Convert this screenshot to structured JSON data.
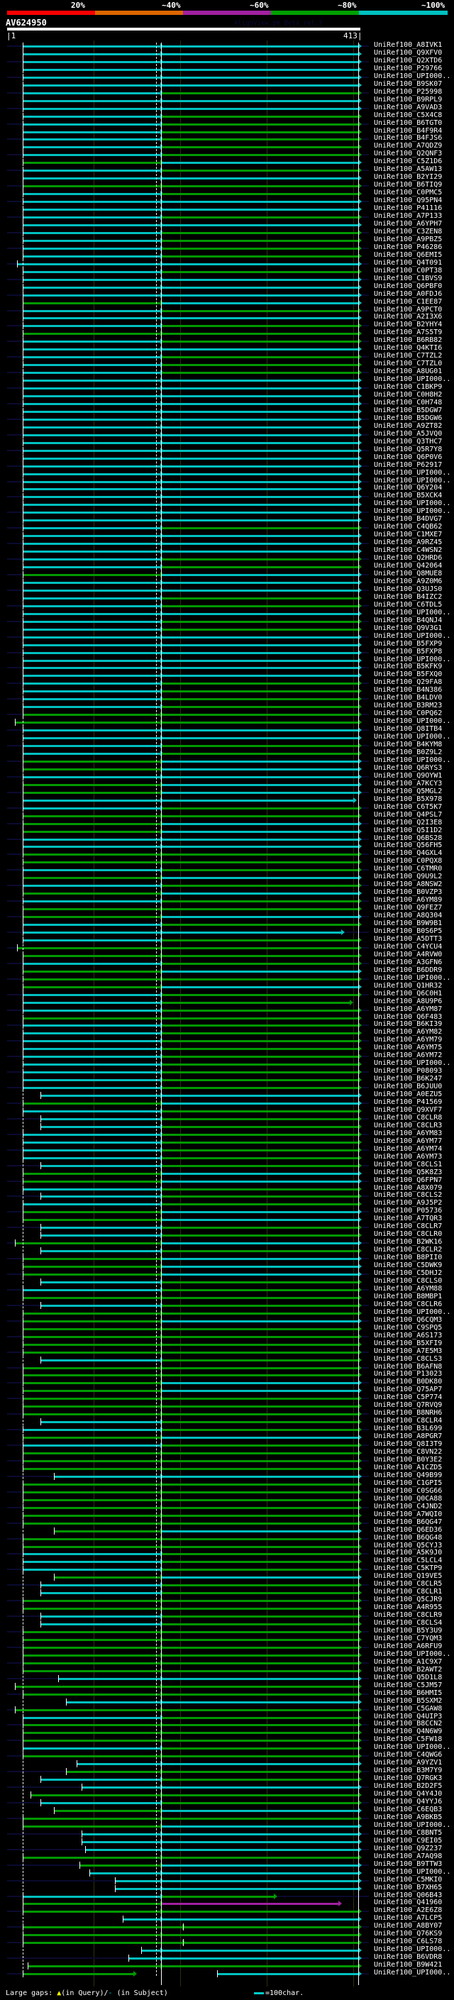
{
  "header": {
    "percent_labels": [
      "20%",
      "~40%",
      "~60%",
      "~80%",
      "~100%"
    ],
    "identity_colors": [
      "#ff0000",
      "#dd6600",
      "#a020a0",
      "#00a000",
      "#00c0c0"
    ],
    "query_name": "AV624950",
    "credit": "AlignView.pm Beta rel.7",
    "query_start": "|1",
    "query_end": "413|",
    "query_length": 413
  },
  "colors": {
    "c": "#00c0c0",
    "g": "#009900",
    "m": "#a020a0"
  },
  "hits": [
    {
      "label": "UniRef100_A8IVK1",
      "c": "cc"
    },
    {
      "label": "UniRef100_Q9XFV0",
      "c": "cc"
    },
    {
      "label": "UniRef100_Q2XTD6",
      "c": "cc"
    },
    {
      "label": "UniRef100_P29766",
      "c": "cc"
    },
    {
      "label": "UniRef100_UPI000..",
      "c": "cc"
    },
    {
      "label": "UniRef100_B9SK07",
      "c": "cc"
    },
    {
      "label": "UniRef100_P25998",
      "c": "cg"
    },
    {
      "label": "UniRef100_B9RPL9",
      "c": "cc"
    },
    {
      "label": "UniRef100_A9VAD3",
      "c": "cc"
    },
    {
      "label": "UniRef100_C5X4C8",
      "c": "cg"
    },
    {
      "label": "UniRef100_B6TGT0",
      "c": "cg"
    },
    {
      "label": "UniRef100_B4F9R4",
      "c": "cg"
    },
    {
      "label": "UniRef100_B4FJS6",
      "c": "cg"
    },
    {
      "label": "UniRef100_A7QDZ9",
      "c": "cg"
    },
    {
      "label": "UniRef100_Q2QNF3",
      "c": "cg"
    },
    {
      "label": "UniRef100_C5Z1D6",
      "c": "gc"
    },
    {
      "label": "UniRef100_A5AW13",
      "c": "cg"
    },
    {
      "label": "UniRef100_B2YI29",
      "c": "cc"
    },
    {
      "label": "UniRef100_B6TIQ9",
      "c": "gg"
    },
    {
      "label": "UniRef100_C0PMC5",
      "c": "cg"
    },
    {
      "label": "UniRef100_Q95PN4",
      "c": "cc"
    },
    {
      "label": "UniRef100_P41116",
      "c": "cc"
    },
    {
      "label": "UniRef100_A7P133",
      "c": "cg"
    },
    {
      "label": "UniRef100_A6YPH7",
      "c": "cc"
    },
    {
      "label": "UniRef100_C3ZEN8",
      "c": "cg"
    },
    {
      "label": "UniRef100_A9PBZ5",
      "c": "cg"
    },
    {
      "label": "UniRef100_P46286",
      "c": "cg"
    },
    {
      "label": "UniRef100_Q6EMI5",
      "c": "cg"
    },
    {
      "label": "UniRef100_Q4T091",
      "c": "cc",
      "s": 13
    },
    {
      "label": "UniRef100_C0PT38",
      "c": "cg"
    },
    {
      "label": "UniRef100_C1BVS9",
      "c": "cc"
    },
    {
      "label": "UniRef100_Q6PBF0",
      "c": "cc"
    },
    {
      "label": "UniRef100_A0FDJ6",
      "c": "cc"
    },
    {
      "label": "UniRef100_C1EE87",
      "c": "gc"
    },
    {
      "label": "UniRef100_A9PCT0",
      "c": "cg"
    },
    {
      "label": "UniRef100_A2I3X6",
      "c": "cc"
    },
    {
      "label": "UniRef100_B2YHY4",
      "c": "cg"
    },
    {
      "label": "UniRef100_A7S5T9",
      "c": "gg"
    },
    {
      "label": "UniRef100_B6RB82",
      "c": "cg"
    },
    {
      "label": "UniRef100_Q4KTI6",
      "c": "cc"
    },
    {
      "label": "UniRef100_C7TZL2",
      "c": "cg"
    },
    {
      "label": "UniRef100_C7TZL0",
      "c": "cg"
    },
    {
      "label": "UniRef100_A8UG01",
      "c": "cg"
    },
    {
      "label": "UniRef100_UPI000..",
      "c": "cc"
    },
    {
      "label": "UniRef100_C1BKP9",
      "c": "cc"
    },
    {
      "label": "UniRef100_C0H8H2",
      "c": "cc"
    },
    {
      "label": "UniRef100_C0H748",
      "c": "cc"
    },
    {
      "label": "UniRef100_B5DGW7",
      "c": "cc"
    },
    {
      "label": "UniRef100_B5DGW6",
      "c": "cc"
    },
    {
      "label": "UniRef100_A9ZT82",
      "c": "cc"
    },
    {
      "label": "UniRef100_A5JVQ0",
      "c": "cc"
    },
    {
      "label": "UniRef100_Q3THC7",
      "c": "cc"
    },
    {
      "label": "UniRef100_Q5R7Y8",
      "c": "cc"
    },
    {
      "label": "UniRef100_Q6P0V6",
      "c": "cc"
    },
    {
      "label": "UniRef100_P62917",
      "c": "cc"
    },
    {
      "label": "UniRef100_UPI000..",
      "c": "cc"
    },
    {
      "label": "UniRef100_UPI000..",
      "c": "cc"
    },
    {
      "label": "UniRef100_Q6Y204",
      "c": "cc"
    },
    {
      "label": "UniRef100_B5XCK4",
      "c": "cc"
    },
    {
      "label": "UniRef100_UPI000..",
      "c": "cc"
    },
    {
      "label": "UniRef100_UPI000..",
      "c": "cc"
    },
    {
      "label": "UniRef100_B4DVG7",
      "c": "cc"
    },
    {
      "label": "UniRef100_C4QB62",
      "c": "cg"
    },
    {
      "label": "UniRef100_C1MXE7",
      "c": "cc"
    },
    {
      "label": "UniRef100_A9RZ45",
      "c": "cc"
    },
    {
      "label": "UniRef100_C4WSN2",
      "c": "cc"
    },
    {
      "label": "UniRef100_Q2HRD6",
      "c": "cg"
    },
    {
      "label": "UniRef100_Q42064",
      "c": "cg"
    },
    {
      "label": "UniRef100_Q8MUE8",
      "c": "gc"
    },
    {
      "label": "UniRef100_A9Z0M6",
      "c": "cc"
    },
    {
      "label": "UniRef100_Q3UJS0",
      "c": "cc"
    },
    {
      "label": "UniRef100_B4IZC2",
      "c": "cg"
    },
    {
      "label": "UniRef100_C6TDL5",
      "c": "cg"
    },
    {
      "label": "UniRef100_UPI000..",
      "c": "cc"
    },
    {
      "label": "UniRef100_B4QNJ4",
      "c": "cg"
    },
    {
      "label": "UniRef100_Q9V3G1",
      "c": "cg"
    },
    {
      "label": "UniRef100_UPI000..",
      "c": "cc"
    },
    {
      "label": "UniRef100_B5FXP9",
      "c": "cc"
    },
    {
      "label": "UniRef100_B5FXP8",
      "c": "cc"
    },
    {
      "label": "UniRef100_UPI000..",
      "c": "cc"
    },
    {
      "label": "UniRef100_B5KFK9",
      "c": "cc"
    },
    {
      "label": "UniRef100_B5FXQ0",
      "c": "cc"
    },
    {
      "label": "UniRef100_Q29FA8",
      "c": "cg"
    },
    {
      "label": "UniRef100_B4N386",
      "c": "cg"
    },
    {
      "label": "UniRef100_B4LDV0",
      "c": "cg"
    },
    {
      "label": "UniRef100_B3RM23",
      "c": "cg"
    },
    {
      "label": "UniRef100_C0PQ62",
      "c": "gg"
    },
    {
      "label": "UniRef100_UPI000..",
      "c": "gg",
      "s": 10
    },
    {
      "label": "UniRef100_Q8ITB4",
      "c": "cc"
    },
    {
      "label": "UniRef100_UPI000..",
      "c": "cc"
    },
    {
      "label": "UniRef100_B4KYM8",
      "c": "cg"
    },
    {
      "label": "UniRef100_B0Z9L2",
      "c": "cg"
    },
    {
      "label": "UniRef100_UPI000..",
      "c": "gc"
    },
    {
      "label": "UniRef100_Q6RYS3",
      "c": "gc"
    },
    {
      "label": "UniRef100_Q9OYW1",
      "c": "cc"
    },
    {
      "label": "UniRef100_A7KCY3",
      "c": "gc"
    },
    {
      "label": "UniRef100_Q5MGL2",
      "c": "gc"
    },
    {
      "label": "UniRef100_B5X978",
      "c": "cc",
      "e": 407
    },
    {
      "label": "UniRef100_C6T5K7",
      "c": "cg"
    },
    {
      "label": "UniRef100_Q4PSL7",
      "c": "gg"
    },
    {
      "label": "UniRef100_Q2I3E8",
      "c": "gc"
    },
    {
      "label": "UniRef100_Q5I1D2",
      "c": "gc"
    },
    {
      "label": "UniRef100_Q6BS28",
      "c": "cc"
    },
    {
      "label": "UniRef100_Q56FH5",
      "c": "cc"
    },
    {
      "label": "UniRef100_Q4GXL4",
      "c": "gg"
    },
    {
      "label": "UniRef100_C0PQX8",
      "c": "gg"
    },
    {
      "label": "UniRef100_C6TMR0",
      "c": "cg"
    },
    {
      "label": "UniRef100_Q9U9L2",
      "c": "gc"
    },
    {
      "label": "UniRef100_A8NSW2",
      "c": "cg"
    },
    {
      "label": "UniRef100_B0VZP3",
      "c": "gc"
    },
    {
      "label": "UniRef100_A6YM89",
      "c": "cg"
    },
    {
      "label": "UniRef100_Q9FEZ7",
      "c": "gg"
    },
    {
      "label": "UniRef100_A8Q304",
      "c": "gc"
    },
    {
      "label": "UniRef100_B9W9B1",
      "c": "cg"
    },
    {
      "label": "UniRef100_B0S6P5",
      "c": "cc",
      "e": 393
    },
    {
      "label": "UniRef100_A5DTT3",
      "c": "cg"
    },
    {
      "label": "UniRef100_C4YCU4",
      "c": "gg",
      "s": 13
    },
    {
      "label": "UniRef100_A4RVW0",
      "c": "gg"
    },
    {
      "label": "UniRef100_A3GFN6",
      "c": "cg"
    },
    {
      "label": "UniRef100_B6DDR9",
      "c": "gc"
    },
    {
      "label": "UniRef100_UPI000..",
      "c": "gg"
    },
    {
      "label": "UniRef100_Q1HR32",
      "c": "gc"
    },
    {
      "label": "UniRef100_Q6C0H1",
      "c": "cg"
    },
    {
      "label": "UniRef100_A8U9P6",
      "c": "cg",
      "e": 403
    },
    {
      "label": "UniRef100_A6YM87",
      "c": "cg"
    },
    {
      "label": "UniRef100_Q6F483",
      "c": "gg"
    },
    {
      "label": "UniRef100_B6KI39",
      "c": "cg"
    },
    {
      "label": "UniRef100_A6YM82",
      "c": "cg"
    },
    {
      "label": "UniRef100_A6YM79",
      "c": "cg"
    },
    {
      "label": "UniRef100_A6YM75",
      "c": "cg"
    },
    {
      "label": "UniRef100_A6YM72",
      "c": "cg"
    },
    {
      "label": "UniRef100_UPI000..",
      "c": "cg"
    },
    {
      "label": "UniRef100_P08093",
      "c": "cg"
    },
    {
      "label": "UniRef100_B6K247",
      "c": "cg"
    },
    {
      "label": "UniRef100_B6JUU0",
      "c": "cg"
    },
    {
      "label": "UniRef100_A0EZU5",
      "c": "cc",
      "s": 40
    },
    {
      "label": "UniRef100_P41569",
      "c": "gc"
    },
    {
      "label": "UniRef100_Q9XVF7",
      "c": "cg"
    },
    {
      "label": "UniRef100_C8CLR8",
      "c": "cg",
      "s": 40
    },
    {
      "label": "UniRef100_C8CLR3",
      "c": "cg",
      "s": 40
    },
    {
      "label": "UniRef100_A6YM83",
      "c": "cg"
    },
    {
      "label": "UniRef100_A6YM77",
      "c": "cg"
    },
    {
      "label": "UniRef100_A6YM74",
      "c": "cg"
    },
    {
      "label": "UniRef100_A6YM73",
      "c": "cg"
    },
    {
      "label": "UniRef100_C8CLS1",
      "c": "cg",
      "s": 40
    },
    {
      "label": "UniRef100_Q5K8Z3",
      "c": "gc"
    },
    {
      "label": "UniRef100_Q6FPN7",
      "c": "gc"
    },
    {
      "label": "UniRef100_A8X079",
      "c": "cg"
    },
    {
      "label": "UniRef100_C8CLS2",
      "c": "cg",
      "s": 40
    },
    {
      "label": "UniRef100_A9J5P2",
      "c": "cg"
    },
    {
      "label": "UniRef100_P05736",
      "c": "gc"
    },
    {
      "label": "UniRef100_A7TQR3",
      "c": "gc"
    },
    {
      "label": "UniRef100_C8CLR7",
      "c": "cg",
      "s": 40
    },
    {
      "label": "UniRef100_C8CLR0",
      "c": "cg",
      "s": 40
    },
    {
      "label": "UniRef100_B2WK16",
      "c": "gc",
      "s": 10
    },
    {
      "label": "UniRef100_C8CLR2",
      "c": "cg",
      "s": 40
    },
    {
      "label": "UniRef100_B8PII0",
      "c": "gc"
    },
    {
      "label": "UniRef100_C5DWK9",
      "c": "gc"
    },
    {
      "label": "UniRef100_C5DHJ2",
      "c": "gc"
    },
    {
      "label": "UniRef100_C8CLS0",
      "c": "cg",
      "s": 40
    },
    {
      "label": "UniRef100_A6YM88",
      "c": "cg"
    },
    {
      "label": "UniRef100_B8MBP1",
      "c": "gg"
    },
    {
      "label": "UniRef100_C8CLR6",
      "c": "cg",
      "s": 40
    },
    {
      "label": "UniRef100_UPI000..",
      "c": "gg"
    },
    {
      "label": "UniRef100_Q6CQM3",
      "c": "gc"
    },
    {
      "label": "UniRef100_C9SPQ5",
      "c": "gg"
    },
    {
      "label": "UniRef100_A6S173",
      "c": "gg"
    },
    {
      "label": "UniRef100_B5XFI9",
      "c": "gg"
    },
    {
      "label": "UniRef100_A7E5M3",
      "c": "gg"
    },
    {
      "label": "UniRef100_C8CLS3",
      "c": "cg",
      "s": 40
    },
    {
      "label": "UniRef100_B6AFN8",
      "c": "gg"
    },
    {
      "label": "UniRef100_P13023",
      "c": "gg"
    },
    {
      "label": "UniRef100_B0DK80",
      "c": "gc"
    },
    {
      "label": "UniRef100_Q75AP7",
      "c": "gc"
    },
    {
      "label": "UniRef100_C5P774",
      "c": "gg"
    },
    {
      "label": "UniRef100_Q7RVQ9",
      "c": "gg"
    },
    {
      "label": "UniRef100_B8NRH6",
      "c": "gg"
    },
    {
      "label": "UniRef100_C8CLR4",
      "c": "cg",
      "s": 40
    },
    {
      "label": "UniRef100_B3L699",
      "c": "cg"
    },
    {
      "label": "UniRef100_A8PGR7",
      "c": "gc"
    },
    {
      "label": "UniRef100_Q8I3T9",
      "c": "cg"
    },
    {
      "label": "UniRef100_C8VN22",
      "c": "gg"
    },
    {
      "label": "UniRef100_B0Y3E2",
      "c": "gg"
    },
    {
      "label": "UniRef100_A1CZD5",
      "c": "gg"
    },
    {
      "label": "UniRef100_Q49B99",
      "c": "cc",
      "s": 56
    },
    {
      "label": "UniRef100_C1GPI5",
      "c": "gg"
    },
    {
      "label": "UniRef100_C0SG66",
      "c": "gg"
    },
    {
      "label": "UniRef100_Q0CA88",
      "c": "gg"
    },
    {
      "label": "UniRef100_C4JND2",
      "c": "gg"
    },
    {
      "label": "UniRef100_A7WQI0",
      "c": "gg"
    },
    {
      "label": "UniRef100_B6QG47",
      "c": "gg"
    },
    {
      "label": "UniRef100_Q6ED36",
      "c": "gc",
      "s": 56
    },
    {
      "label": "UniRef100_B6QG48",
      "c": "gg"
    },
    {
      "label": "UniRef100_Q5CYJ3",
      "c": "gg"
    },
    {
      "label": "UniRef100_A5K9J0",
      "c": "cg"
    },
    {
      "label": "UniRef100_C5LCL4",
      "c": "cg"
    },
    {
      "label": "UniRef100_C5KTP9",
      "c": "cg"
    },
    {
      "label": "UniRef100_Q19VE5",
      "c": "gc",
      "s": 56
    },
    {
      "label": "UniRef100_C8CLR5",
      "c": "cg",
      "s": 40
    },
    {
      "label": "UniRef100_C8CLR1",
      "c": "cg",
      "s": 40
    },
    {
      "label": "UniRef100_Q5CJR9",
      "c": "gg"
    },
    {
      "label": "UniRef100_A4R955",
      "c": "gg"
    },
    {
      "label": "UniRef100_C8CLR9",
      "c": "cg",
      "s": 40
    },
    {
      "label": "UniRef100_C8CLS4",
      "c": "cg",
      "s": 40
    },
    {
      "label": "UniRef100_B5Y3U9",
      "c": "gg"
    },
    {
      "label": "UniRef100_C7YQM3",
      "c": "gg"
    },
    {
      "label": "UniRef100_A6RFU9",
      "c": "gg"
    },
    {
      "label": "UniRef100_UPI000..",
      "c": "gg"
    },
    {
      "label": "UniRef100_A1C9X7",
      "c": "gg"
    },
    {
      "label": "UniRef100_B2AWT2",
      "c": "gg"
    },
    {
      "label": "UniRef100_Q5D1L8",
      "c": "cc",
      "s": 61
    },
    {
      "label": "UniRef100_C5JM57",
      "c": "gg",
      "s": 10
    },
    {
      "label": "UniRef100_B6HMI5",
      "c": "gg"
    },
    {
      "label": "UniRef100_B5SXM2",
      "c": "cc",
      "s": 70
    },
    {
      "label": "UniRef100_C5GAW8",
      "c": "gg",
      "s": 10
    },
    {
      "label": "UniRef100_Q4UIP3",
      "c": "cg"
    },
    {
      "label": "UniRef100_B8CCN2",
      "c": "gg"
    },
    {
      "label": "UniRef100_Q4N6W9",
      "c": "gg"
    },
    {
      "label": "UniRef100_C5FW18",
      "c": "gg"
    },
    {
      "label": "UniRef100_UPI000..",
      "c": "cg"
    },
    {
      "label": "UniRef100_C4QWG6",
      "c": "gg"
    },
    {
      "label": "UniRef100_A9YZV1",
      "c": "cc",
      "s": 82
    },
    {
      "label": "UniRef100_B3M7Y9",
      "c": "gg",
      "s": 70
    },
    {
      "label": "UniRef100_Q7RGK3",
      "c": "cg",
      "s": 40
    },
    {
      "label": "UniRef100_B2D2F5",
      "c": "cc",
      "s": 88
    },
    {
      "label": "UniRef100_Q4Y4J0",
      "c": "gg",
      "s": 28
    },
    {
      "label": "UniRef100_Q4YYJ6",
      "c": "cg",
      "s": 40
    },
    {
      "label": "UniRef100_C6EQB3",
      "c": "gc",
      "s": 56
    },
    {
      "label": "UniRef100_A9BKB5",
      "c": "gg"
    },
    {
      "label": "UniRef100_UPI000..",
      "c": "gc"
    },
    {
      "label": "UniRef100_C8BNT5",
      "c": "cc",
      "s": 88
    },
    {
      "label": "UniRef100_C9EI05",
      "c": "cc",
      "s": 88
    },
    {
      "label": "UniRef100_Q9Z237",
      "c": "cc",
      "s": 92
    },
    {
      "label": "UniRef100_A7AQ98",
      "c": "gg"
    },
    {
      "label": "UniRef100_B9TTW3",
      "c": "gc",
      "s": 86
    },
    {
      "label": "UniRef100_UPI000..",
      "c": "cc",
      "s": 97
    },
    {
      "label": "UniRef100_C5MKI0",
      "c": "cc",
      "s": 127
    },
    {
      "label": "UniRef100_B7XH65",
      "c": "cc",
      "s": 127
    },
    {
      "label": "UniRef100_Q06B43",
      "c": "cg",
      "e": 314
    },
    {
      "label": "UniRef100_Q41960",
      "c": "gm",
      "e": 390
    },
    {
      "label": "UniRef100_A2E6Z8",
      "c": "gg"
    },
    {
      "label": "UniRef100_A7LCP5",
      "c": "cc",
      "s": 136
    },
    {
      "label": "UniRef100_A8BY07",
      "c": "gg",
      "split": 207
    },
    {
      "label": "UniRef100_Q76KS9",
      "c": "gg"
    },
    {
      "label": "UniRef100_C6LS78",
      "c": "gg",
      "split": 207
    },
    {
      "label": "UniRef100_UPI000..",
      "c": "cc",
      "s": 158
    },
    {
      "label": "UniRef100_B6VDR8",
      "c": "cc",
      "s": 143
    },
    {
      "label": "UniRef100_B9W421",
      "c": "gg",
      "s": 25
    },
    {
      "label": "UniRef100_UPI000..",
      "c": "gc",
      "split": 150,
      "s2": 247
    }
  ],
  "footer": {
    "gaps_label": "Large gaps:",
    "query_gap_symbol": "▲",
    "query_gap_text": "(in Query)/",
    "subject_gap_symbol": "-",
    "subject_gap_text": " (in Subject)",
    "scale_text": "=100char."
  }
}
